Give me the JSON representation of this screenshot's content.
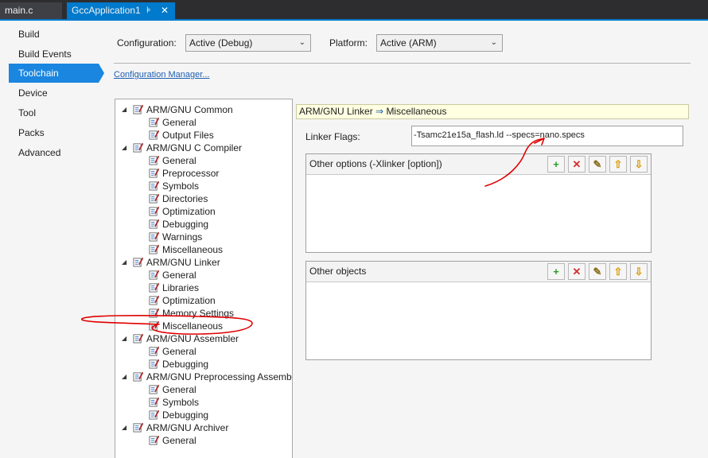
{
  "tabs": [
    {
      "label": "main.c"
    },
    {
      "label": "GccApplication1",
      "pin_glyph": "⊧",
      "close_glyph": "✕"
    }
  ],
  "sidebar": {
    "items": [
      {
        "label": "Build"
      },
      {
        "label": "Build Events"
      },
      {
        "label": "Toolchain"
      },
      {
        "label": "Device"
      },
      {
        "label": "Tool"
      },
      {
        "label": "Packs"
      },
      {
        "label": "Advanced"
      }
    ],
    "active": "Toolchain"
  },
  "config": {
    "configuration_label": "Configuration:",
    "configuration_value": "Active (Debug)",
    "platform_label": "Platform:",
    "platform_value": "Active (ARM)",
    "manager_link": "Configuration Manager..."
  },
  "tree": [
    {
      "label": "ARM/GNU Common",
      "level": 0,
      "expanded": true
    },
    {
      "label": "General",
      "level": 1
    },
    {
      "label": "Output Files",
      "level": 1
    },
    {
      "label": "ARM/GNU C Compiler",
      "level": 0,
      "expanded": true
    },
    {
      "label": "General",
      "level": 1
    },
    {
      "label": "Preprocessor",
      "level": 1
    },
    {
      "label": "Symbols",
      "level": 1
    },
    {
      "label": "Directories",
      "level": 1
    },
    {
      "label": "Optimization",
      "level": 1
    },
    {
      "label": "Debugging",
      "level": 1
    },
    {
      "label": "Warnings",
      "level": 1
    },
    {
      "label": "Miscellaneous",
      "level": 1
    },
    {
      "label": "ARM/GNU Linker",
      "level": 0,
      "expanded": true
    },
    {
      "label": "General",
      "level": 1
    },
    {
      "label": "Libraries",
      "level": 1
    },
    {
      "label": "Optimization",
      "level": 1
    },
    {
      "label": "Memory Settings",
      "level": 1
    },
    {
      "label": "Miscellaneous",
      "level": 1,
      "selected": true
    },
    {
      "label": "ARM/GNU Assembler",
      "level": 0,
      "expanded": true
    },
    {
      "label": "General",
      "level": 1
    },
    {
      "label": "Debugging",
      "level": 1
    },
    {
      "label": "ARM/GNU Preprocessing Assembler",
      "level": 0,
      "expanded": true
    },
    {
      "label": "General",
      "level": 1
    },
    {
      "label": "Symbols",
      "level": 1
    },
    {
      "label": "Debugging",
      "level": 1
    },
    {
      "label": "ARM/GNU Archiver",
      "level": 0,
      "expanded": true
    },
    {
      "label": "General",
      "level": 1
    }
  ],
  "breadcrumb": {
    "parent": "ARM/GNU Linker",
    "arrow": "⇒",
    "current": "Miscellaneous"
  },
  "linker_flags": {
    "label": "Linker Flags:",
    "value": "-Tsamc21e15a_flash.ld --specs=nano.specs"
  },
  "panels": [
    {
      "title": "Other options (-Xlinker [option])",
      "buttons": [
        "add-icon",
        "delete-icon",
        "edit-icon",
        "move-up-icon",
        "move-down-icon"
      ]
    },
    {
      "title": "Other objects",
      "buttons": [
        "add-icon",
        "delete-icon",
        "edit-icon",
        "move-up-icon",
        "move-down-icon"
      ]
    }
  ],
  "colors": {
    "accent": "#1a86e0",
    "tab_active": "#007acc",
    "annotation": "#e00000"
  }
}
